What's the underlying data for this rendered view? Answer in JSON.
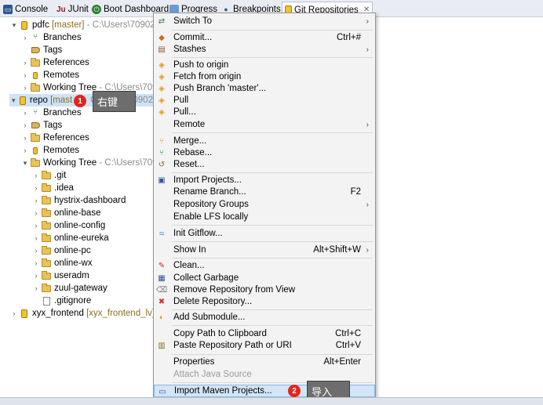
{
  "tabs": [
    {
      "label": "Console",
      "icon": "console-icon"
    },
    {
      "label": "JUnit",
      "icon": "junit-icon",
      "prefix": "Ju"
    },
    {
      "label": "Boot Dashboard",
      "icon": "power-icon"
    },
    {
      "label": "Progress",
      "icon": "progress-icon"
    },
    {
      "label": "Breakpoints",
      "icon": "breakpoints-icon"
    },
    {
      "label": "Git Repositories",
      "icon": "git-icon",
      "close": "✕"
    }
  ],
  "tree": {
    "pdfc": {
      "name": "pdfc",
      "branch": "[master]",
      "path": "- C:\\Users\\70902\\"
    },
    "pdfc_children": [
      "Branches",
      "Tags",
      "References",
      "Remotes"
    ],
    "pdfc_working_tree": {
      "name": "Working Tree",
      "path": "- C:\\Users\\709"
    },
    "repo": {
      "name": "repo",
      "branch": "[mast",
      "path": "C:\\Users\\70902"
    },
    "repo_children": [
      "Branches",
      "Tags",
      "References",
      "Remotes"
    ],
    "repo_working_tree": {
      "name": "Working Tree",
      "path": "- C:\\Users\\709"
    },
    "repo_folders": [
      ".git",
      ".idea",
      "hystrix-dashboard",
      "online-base",
      "online-config",
      "online-eureka",
      "online-pc",
      "online-wx",
      "useradm",
      "zuul-gateway"
    ],
    "repo_file": ".gitignore",
    "xyx": {
      "name": "xyx_frontend",
      "branch": "[xyx_frontend_lv]"
    }
  },
  "menu": {
    "items": [
      {
        "label": "Switch To",
        "icon": "switch-icon",
        "submenu": true
      },
      {
        "label": "Commit...",
        "icon": "commit-icon",
        "accel": "Ctrl+#"
      },
      {
        "label": "Stashes",
        "icon": "stash-icon",
        "submenu": true
      },
      {
        "label": "Push to origin",
        "icon": "push-icon"
      },
      {
        "label": "Fetch from origin",
        "icon": "fetch-icon"
      },
      {
        "label": "Push Branch 'master'...",
        "icon": "push-branch-icon"
      },
      {
        "label": "Pull",
        "icon": "pull-icon"
      },
      {
        "label": "Pull...",
        "icon": "pull-dialog-icon"
      },
      {
        "label": "Remote",
        "icon": "",
        "submenu": true
      },
      {
        "label": "Merge...",
        "icon": "merge-icon"
      },
      {
        "label": "Rebase...",
        "icon": "rebase-icon"
      },
      {
        "label": "Reset...",
        "icon": "reset-icon"
      },
      {
        "label": "Import Projects...",
        "icon": "import-icon"
      },
      {
        "label": "Rename Branch...",
        "icon": "",
        "accel": "F2"
      },
      {
        "label": "Repository Groups",
        "icon": "",
        "submenu": true
      },
      {
        "label": "Enable LFS locally",
        "icon": ""
      },
      {
        "label": "Init Gitflow...",
        "icon": "gitflow-icon"
      },
      {
        "label": "Show In",
        "icon": "",
        "accel": "Alt+Shift+W",
        "submenu": true
      },
      {
        "label": "Clean...",
        "icon": "clean-icon"
      },
      {
        "label": "Collect Garbage",
        "icon": "garbage-icon"
      },
      {
        "label": "Remove Repository from View",
        "icon": "remove-icon"
      },
      {
        "label": "Delete Repository...",
        "icon": "delete-icon"
      },
      {
        "label": "Add Submodule...",
        "icon": "submodule-icon"
      },
      {
        "label": "Copy Path to Clipboard",
        "icon": "",
        "accel": "Ctrl+C"
      },
      {
        "label": "Paste Repository Path or URI",
        "icon": "paste-icon",
        "accel": "Ctrl+V"
      },
      {
        "label": "Properties",
        "icon": "",
        "accel": "Alt+Enter"
      },
      {
        "label": "Attach Java Source",
        "icon": "",
        "disabled": true
      },
      {
        "label": "Import Maven Projects...",
        "icon": "maven-icon"
      }
    ]
  },
  "callouts": {
    "step1_num": "1",
    "step1_text": "右键",
    "step2_num": "2",
    "step2_text": "导入"
  },
  "colors": {
    "tab_bar": "#e9edf3",
    "menu_bg": "#f3f3f3",
    "selection": "#cfe3f7",
    "badge": "#e1251b",
    "callout": "#6d6d6d"
  }
}
